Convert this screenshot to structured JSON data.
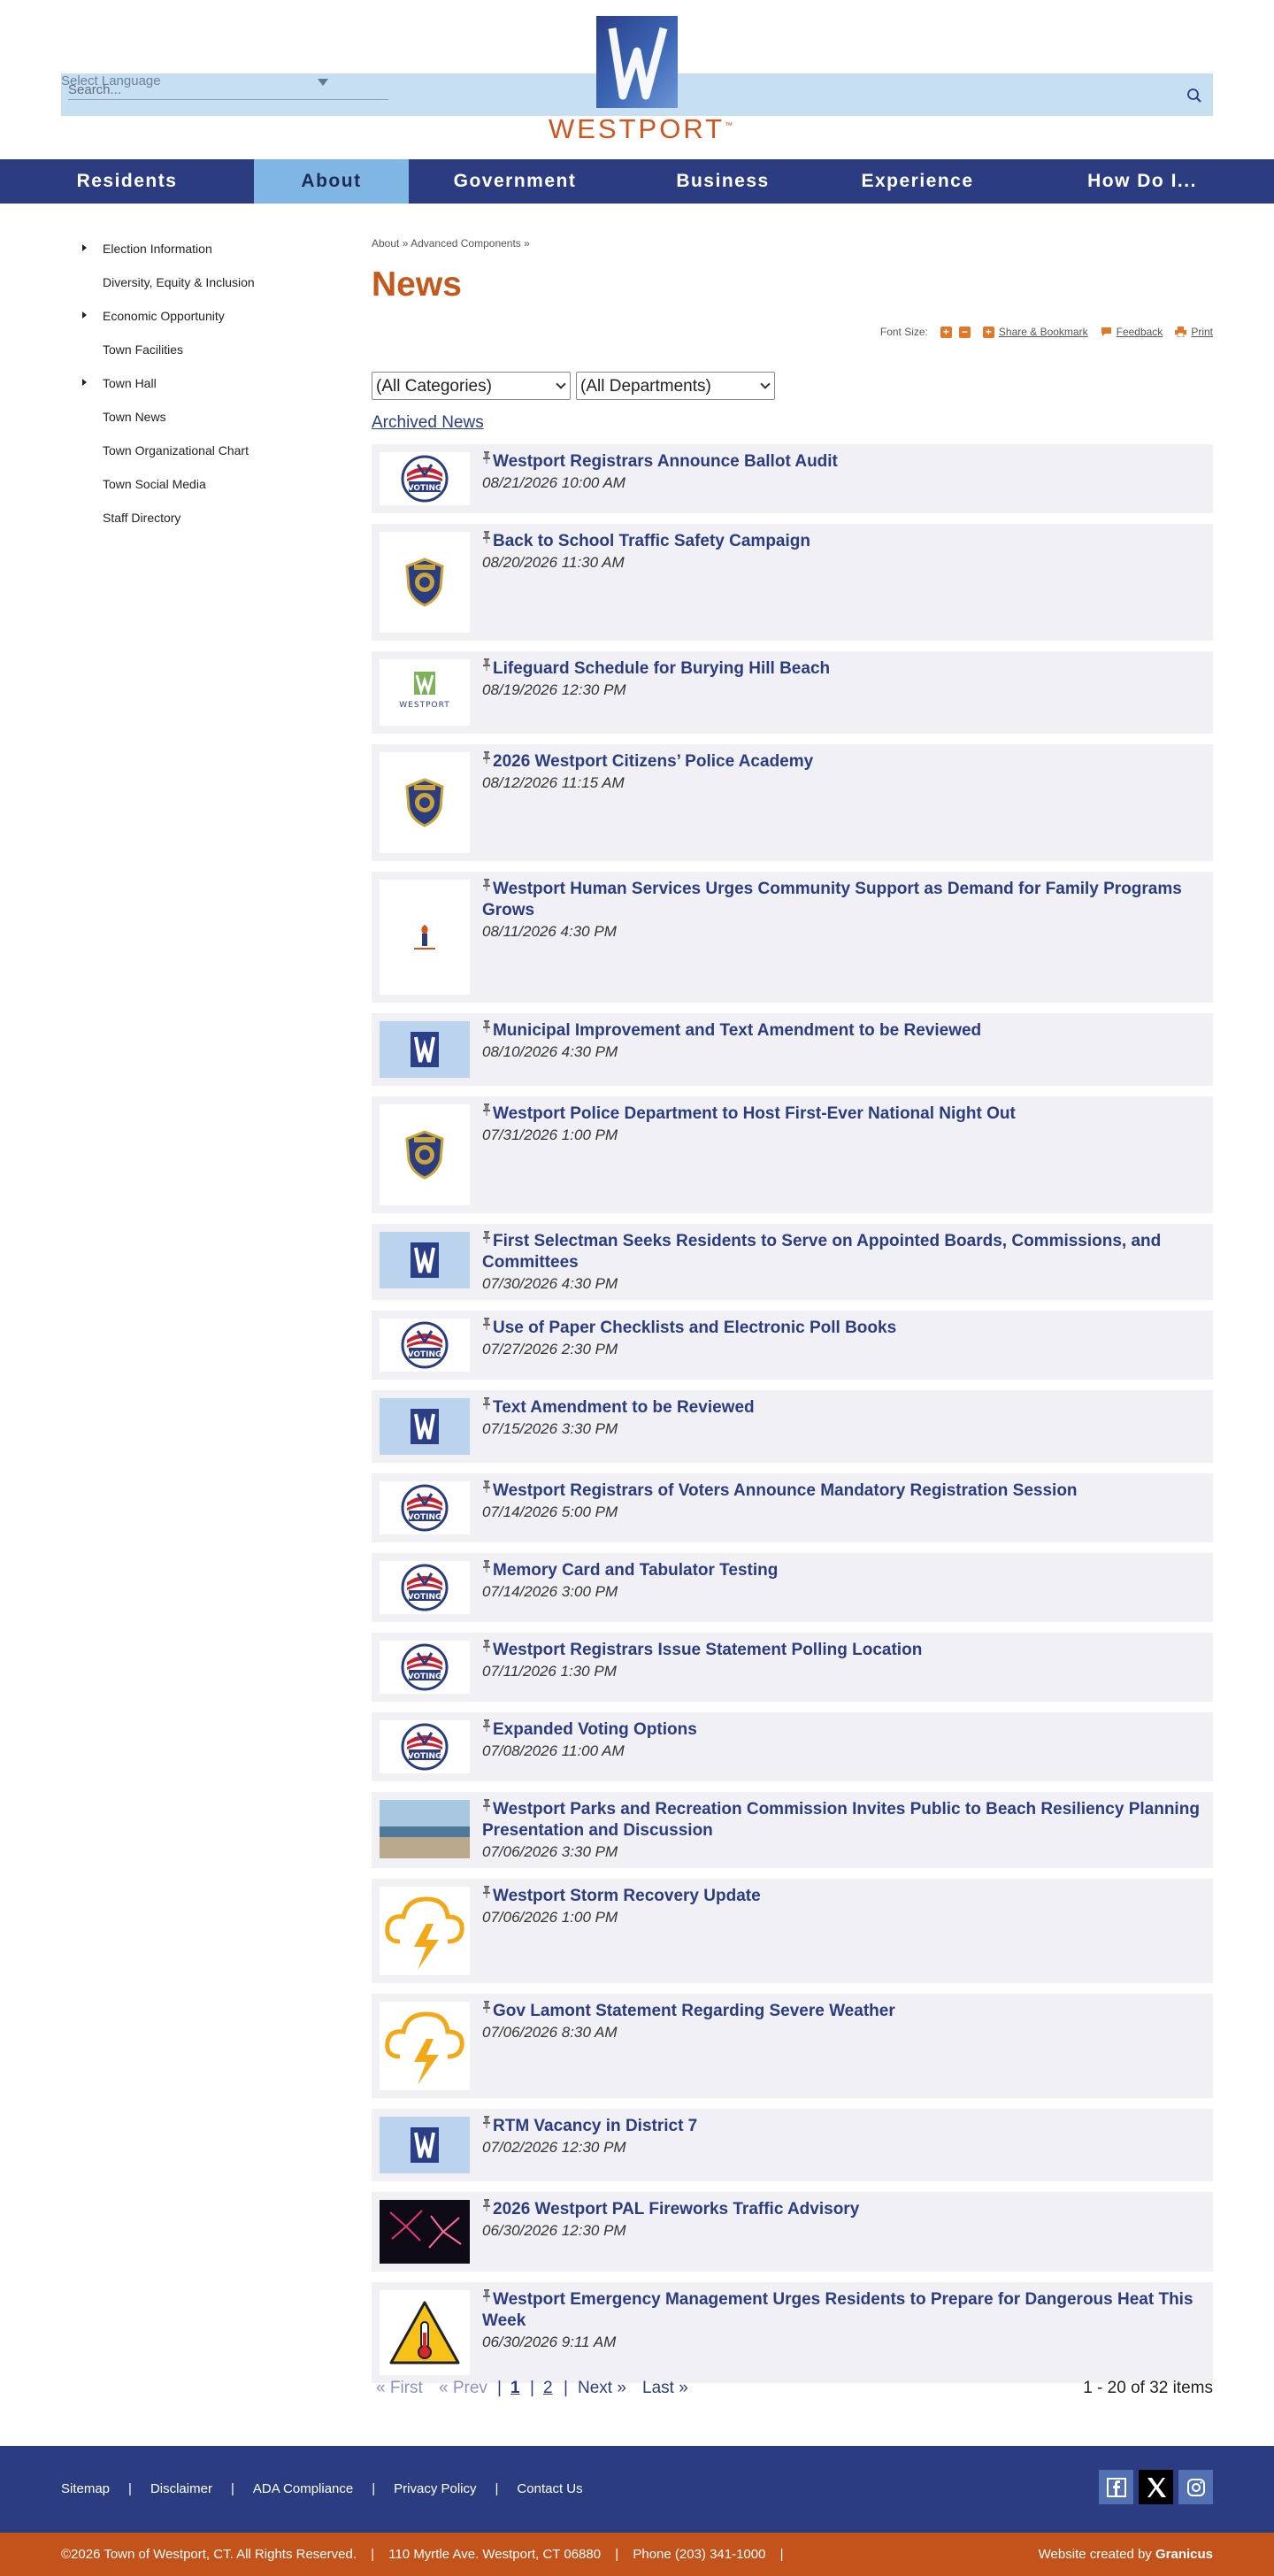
{
  "header": {
    "language_label": "Select Language",
    "search_placeholder": "Search...",
    "logo_text": "WESTPORT"
  },
  "nav": [
    "Residents",
    "About",
    "Government",
    "Business",
    "Experience",
    "How Do I..."
  ],
  "nav_active": "About",
  "sidebar": [
    {
      "label": "Election Information",
      "expandable": true
    },
    {
      "label": "Diversity, Equity & Inclusion",
      "expandable": false
    },
    {
      "label": "Economic Opportunity",
      "expandable": true
    },
    {
      "label": "Town Facilities",
      "expandable": false
    },
    {
      "label": "Town Hall",
      "expandable": true
    },
    {
      "label": "Town News",
      "expandable": false
    },
    {
      "label": "Town Organizational Chart",
      "expandable": false
    },
    {
      "label": "Town Social Media",
      "expandable": false
    },
    {
      "label": "Staff Directory",
      "expandable": false
    }
  ],
  "breadcrumb": {
    "crumb1": "About",
    "sep": "»",
    "crumb2": "Advanced Components",
    "sep2": "»"
  },
  "page_title": "News",
  "tools": {
    "font_size": "Font Size:",
    "share": "Share & Bookmark",
    "feedback": "Feedback",
    "print": "Print"
  },
  "filters": {
    "categories": "(All Categories)",
    "departments": "(All Departments)"
  },
  "archived_link": "Archived News",
  "news": [
    {
      "title": "Westport Registrars Announce Ballot Audit",
      "date": "08/21/2026 10:00 AM",
      "thumb": "voting"
    },
    {
      "title": "Back to School Traffic Safety Campaign",
      "date": "08/20/2026 11:30 AM",
      "thumb": "police"
    },
    {
      "title": "Lifeguard Schedule for Burying Hill Beach",
      "date": "08/19/2026 12:30 PM",
      "thumb": "westport"
    },
    {
      "title": "2026 Westport Citizens’ Police Academy",
      "date": "08/12/2026 11:15 AM",
      "thumb": "police"
    },
    {
      "title": "Westport Human Services Urges Community Support as Demand for Family Programs Grows",
      "date": "08/11/2026 4:30 PM",
      "thumb": "human"
    },
    {
      "title": "Municipal Improvement and Text Amendment to be Reviewed",
      "date": "08/10/2026 4:30 PM",
      "thumb": "w"
    },
    {
      "title": "Westport Police Department to Host First-Ever National Night Out",
      "date": "07/31/2026 1:00 PM",
      "thumb": "police"
    },
    {
      "title": "First Selectman Seeks Residents to Serve on Appointed Boards, Commissions, and Committees",
      "date": "07/30/2026 4:30 PM",
      "thumb": "w"
    },
    {
      "title": "Use of Paper Checklists and Electronic Poll Books",
      "date": "07/27/2026 2:30 PM",
      "thumb": "voting"
    },
    {
      "title": "Text Amendment to be Reviewed",
      "date": "07/15/2026 3:30 PM",
      "thumb": "w"
    },
    {
      "title": "Westport Registrars of Voters Announce Mandatory Registration Session",
      "date": "07/14/2026 5:00 PM",
      "thumb": "voting"
    },
    {
      "title": "Memory Card and Tabulator Testing",
      "date": "07/14/2026 3:00 PM",
      "thumb": "voting"
    },
    {
      "title": "Westport Registrars Issue Statement Polling Location",
      "date": "07/11/2026 1:30 PM",
      "thumb": "voting"
    },
    {
      "title": "Expanded Voting Options",
      "date": "07/08/2026 11:00 AM",
      "thumb": "voting"
    },
    {
      "title": "Westport Parks and Recreation Commission Invites Public to Beach Resiliency Planning Presentation and Discussion",
      "date": "07/06/2026 3:30 PM",
      "thumb": "beach"
    },
    {
      "title": "Westport Storm Recovery Update",
      "date": "07/06/2026 1:00 PM",
      "thumb": "storm"
    },
    {
      "title": "Gov Lamont Statement Regarding Severe Weather",
      "date": "07/06/2026 8:30 AM",
      "thumb": "storm"
    },
    {
      "title": "RTM Vacancy in District 7",
      "date": "07/02/2026 12:30 PM",
      "thumb": "w"
    },
    {
      "title": "2026 Westport PAL Fireworks Traffic Advisory",
      "date": "06/30/2026 12:30 PM",
      "thumb": "fireworks"
    },
    {
      "title": "Westport Emergency Management Urges Residents to Prepare for Dangerous Heat This Week",
      "date": "06/30/2026 9:11 AM",
      "thumb": "heat"
    }
  ],
  "pagination": {
    "first": "« First",
    "prev": "« Prev",
    "sep": "|",
    "page1": "1",
    "page2": "2",
    "next": "Next »",
    "last": "Last »",
    "count": "1 - 20 of 32 items"
  },
  "footer": {
    "links": [
      "Sitemap",
      "Disclaimer",
      "ADA Compliance",
      "Privacy Policy",
      "Contact Us"
    ],
    "link_separator": "|",
    "copyright": "©2026 Town of Westport, CT. All Rights Reserved.",
    "address": "110 Myrtle Ave. Westport, CT 06880",
    "phone": "Phone (203) 341-1000",
    "credit_prefix": "Website created by",
    "credit_brand": "Granicus"
  },
  "colors": {
    "nav_bg": "#2b3d80",
    "nav_active": "#7fb6e3",
    "accent_orange": "#c3591c",
    "title_blue": "#2b3d80",
    "header_bar": "#c7dff3"
  }
}
